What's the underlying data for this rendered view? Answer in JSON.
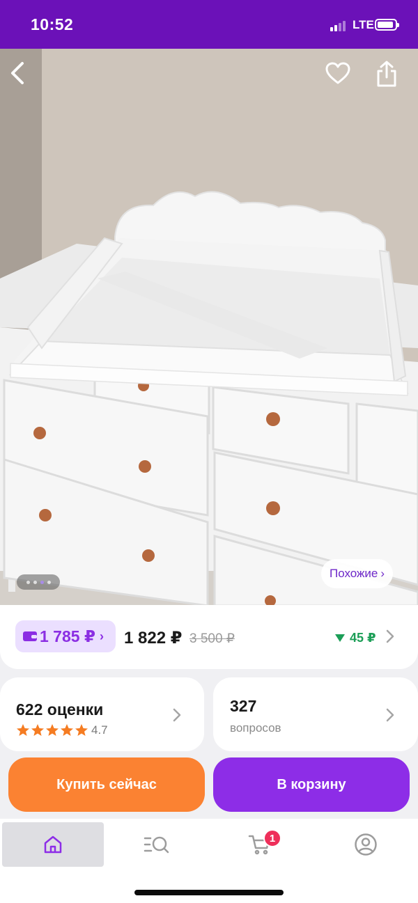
{
  "status_bar": {
    "time": "10:52",
    "network": "LTE",
    "background": "#6b11b8"
  },
  "photo": {
    "back_icon": "chevron-left-icon",
    "favorite_icon": "heart-icon",
    "share_icon": "share-icon",
    "carousel_dots": 4,
    "carousel_active": 2,
    "similar_label": "Похожие",
    "similar_chevron": "›"
  },
  "price": {
    "wallet_price": "1 785 ₽",
    "wallet_chevron": "›",
    "current": "1 822 ₽",
    "old": "3 500 ₽",
    "cashback": "45 ₽",
    "cashback_icon": "triangle-down-icon"
  },
  "ratings": {
    "count_label": "622 оценки",
    "value": "4.7",
    "stars": 5
  },
  "questions": {
    "count": "327",
    "label": "вопросов"
  },
  "actions": {
    "buy_now": "Купить сейчас",
    "add_to_cart": "В корзину"
  },
  "tab_bar": {
    "tabs": [
      {
        "name": "home",
        "icon": "home-icon",
        "active": true
      },
      {
        "name": "catalog",
        "icon": "catalog-search-icon",
        "active": false
      },
      {
        "name": "cart",
        "icon": "cart-icon",
        "active": false,
        "badge": "1"
      },
      {
        "name": "profile",
        "icon": "profile-icon",
        "active": false
      }
    ]
  },
  "colors": {
    "accent_purple": "#8d2de7",
    "accent_orange": "#fb8232",
    "cashback_green": "#1c9e57",
    "badge_red": "#ee2f5a"
  }
}
